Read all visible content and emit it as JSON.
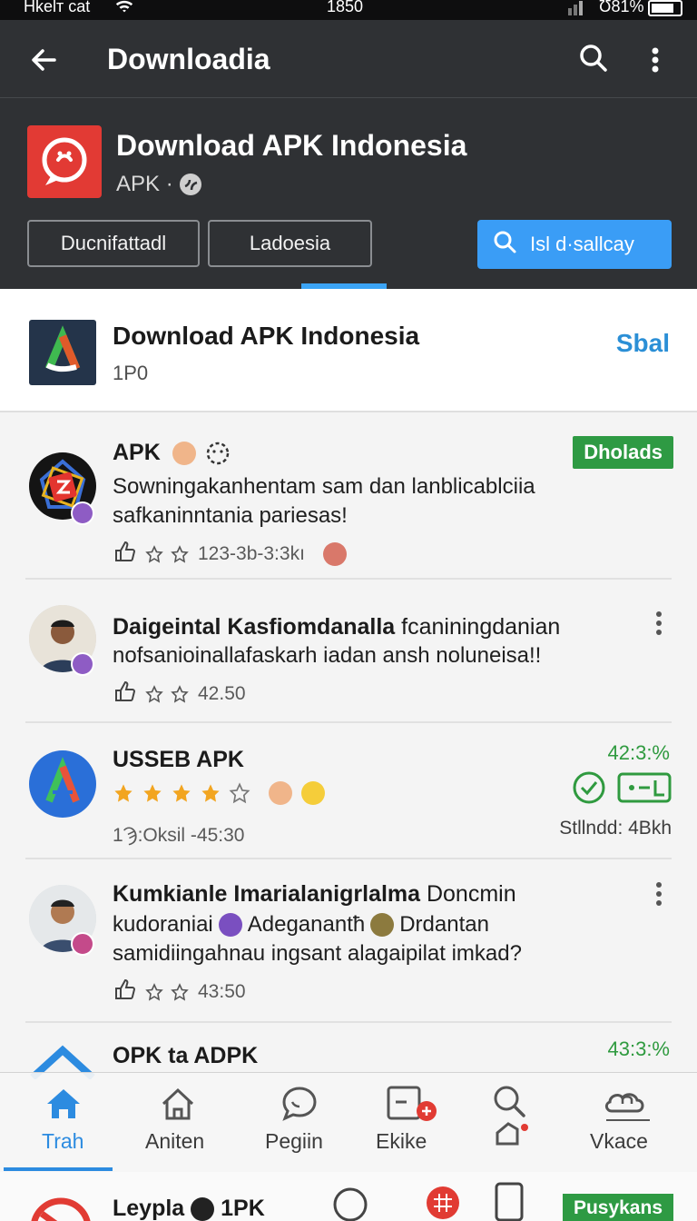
{
  "status_bar": {
    "carrier": "Hkelт cat",
    "time": "1850",
    "battery": "Ʊ81%"
  },
  "appbar": {
    "title": "Downloadia"
  },
  "hero": {
    "title": "Download APK Indonesia",
    "subtitle": "APK ·"
  },
  "chips": {
    "chip1": "Ducnifattadl",
    "chip2": "Ladoesia",
    "search": "Isl d·sallcay"
  },
  "featured": {
    "title": "Download APK Indonesia",
    "subtitle": "1P0",
    "action": "Sbal"
  },
  "items": [
    {
      "title": "APK",
      "line1": "Sowningakanhentam sam dan lanblicablciia",
      "line2": "safkaninntania pariesas!",
      "meta": "123-3b-3:3kı",
      "badge": "Dholads"
    },
    {
      "title_bold": "Daigeintal Kasfiomdanalla",
      "title_rest": " fcaniningdanian",
      "line1": "nofsanioinallafaskarh iadan ansh noluneisa!!",
      "meta": "42.50"
    },
    {
      "title": "USSEB APK",
      "meta": "1Ϡ:Oksil -45:30",
      "percent": "42:3:%",
      "size": "Stllndd: 4Bkh"
    },
    {
      "title_bold": "Kumkianle Imarialanigrlalma",
      "title_rest": " Doncmin",
      "line1a": "kudoraniai",
      "line1b": "Adeganantħ",
      "line1c": "Drdantan",
      "line2": "samidiingahnau ingsant alagaipilat imkad?",
      "meta": "43:50"
    },
    {
      "title": "OPK ta ADPK",
      "percent": "43:3:%"
    }
  ],
  "bottom_nav": [
    {
      "label": "Trah",
      "icon": "home-icon",
      "active": true
    },
    {
      "label": "Aniten",
      "icon": "house-outline-icon"
    },
    {
      "label": "Pegiin",
      "icon": "chat-bubble-icon"
    },
    {
      "label": "Ekike",
      "icon": "inbox-icon"
    },
    {
      "label": "",
      "icon": "search-tag-icon"
    },
    {
      "label": "Vkace",
      "icon": "cloud-lock-icon"
    }
  ],
  "peek": {
    "title": "Leypla",
    "title_suffix": "1PK",
    "badge": "Pusykans"
  },
  "colors": {
    "header": "#2f3134",
    "accent_blue": "#3a9df6",
    "green": "#2e9a43",
    "red": "#e23a34"
  }
}
